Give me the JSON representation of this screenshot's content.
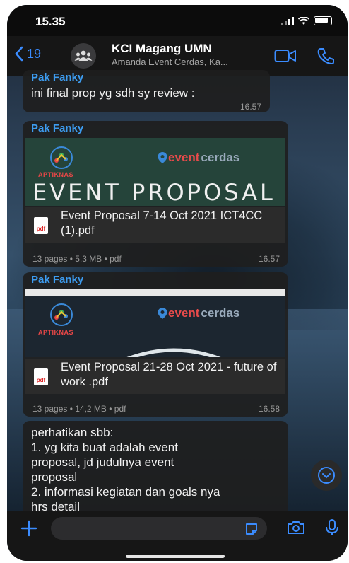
{
  "status_bar": {
    "time": "15.35"
  },
  "header": {
    "back_count": "19",
    "title": "KCI Magang UMN",
    "subtitle": "Amanda Event Cerdas, Ka..."
  },
  "messages": [
    {
      "sender": "Pak Fanky",
      "text": "ini final prop yg sdh sy review :",
      "time": "16.57"
    },
    {
      "sender": "Pak Fanky",
      "preview": {
        "logo_left": "APTIKNAS",
        "logo_right_a": "event",
        "logo_right_b": "cerdas",
        "heading": "EVENT PROPOSAL"
      },
      "file_name": "Event Proposal 7-14 Oct 2021 ICT4CC (1).pdf",
      "file_meta": "13 pages • 5,3 MB • pdf",
      "time": "16.57"
    },
    {
      "sender": "Pak Fanky",
      "preview": {
        "logo_left": "APTIKNAS",
        "logo_right_a": "event",
        "logo_right_b": "cerdas"
      },
      "file_name": "Event Proposal 21-28 Oct 2021 - future of work .pdf",
      "file_meta": "13 pages • 14,2 MB • pdf",
      "time": "16.58"
    },
    {
      "text_lines": [
        "perhatikan sbb:",
        "1. yg kita buat adalah event",
        "proposal, jd judulnya event",
        "proposal",
        "2. informasi kegiatan dan goals nya",
        "hrs detail"
      ]
    }
  ],
  "icons": {
    "back": "chevron-left-icon",
    "avatar": "group-icon",
    "video": "video-camera-icon",
    "call": "phone-icon",
    "scroll": "chevron-down-icon",
    "attach": "plus-icon",
    "sticker": "sticker-icon",
    "camera": "camera-icon",
    "mic": "microphone-icon",
    "pdf_label": "pdf"
  },
  "colors": {
    "accent": "#3b8cff",
    "sender": "#3d9cf0",
    "bubble": "#1e1e1e"
  }
}
